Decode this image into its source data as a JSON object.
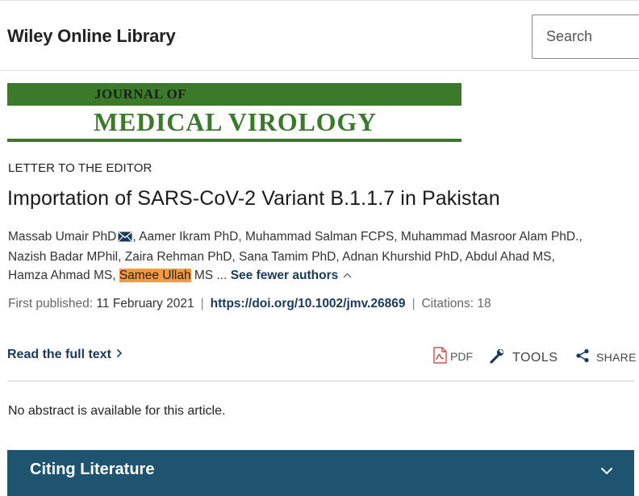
{
  "site": {
    "logo": "Wiley Online Library"
  },
  "search": {
    "placeholder": "Search"
  },
  "journal": {
    "line1": "JOURNAL OF",
    "line2": "MEDICAL VIROLOGY"
  },
  "article": {
    "type": "LETTER TO THE EDITOR",
    "title": "Importation of SARS-CoV-2 Variant B.1.1.7 in Pakistan"
  },
  "authors": [
    {
      "name": "Massab Umair PhD",
      "mail": true
    },
    {
      "name": "Aamer Ikram PhD"
    },
    {
      "name": "Muhammad Salman FCPS"
    },
    {
      "name": "Muhammad Masroor Alam PhD."
    },
    {
      "name": "Nazish Badar MPhil"
    },
    {
      "name": "Zaira Rehman PhD"
    },
    {
      "name": "Sana Tamim PhD"
    },
    {
      "name": "Adnan Khurshid PhD"
    },
    {
      "name": "Abdul Ahad MS"
    },
    {
      "name": "Hamza Ahmad MS"
    },
    {
      "name_highlight": "Samee Ullah",
      "suffix": " MS"
    }
  ],
  "authors_toggle": {
    "ellipsis": "...",
    "label": "See fewer authors"
  },
  "publication": {
    "first_published_label": "First published:",
    "first_published_value": "11 February 2021",
    "doi": "https://doi.org/10.1002/jmv.26869",
    "citations": "Citations: 18"
  },
  "actions": {
    "read_full": "Read the full text",
    "pdf": "PDF",
    "tools": "TOOLS",
    "share": "SHARE"
  },
  "abstract_note": "No abstract is available for this article.",
  "citing": {
    "label": "Citing Literature"
  },
  "colors": {
    "journal_green": "#3a7a2a",
    "link_navy": "#1a3a5c",
    "highlight_orange": "#f79a3d",
    "citing_bar": "#1e5470",
    "pdf_red": "#c0392b"
  }
}
